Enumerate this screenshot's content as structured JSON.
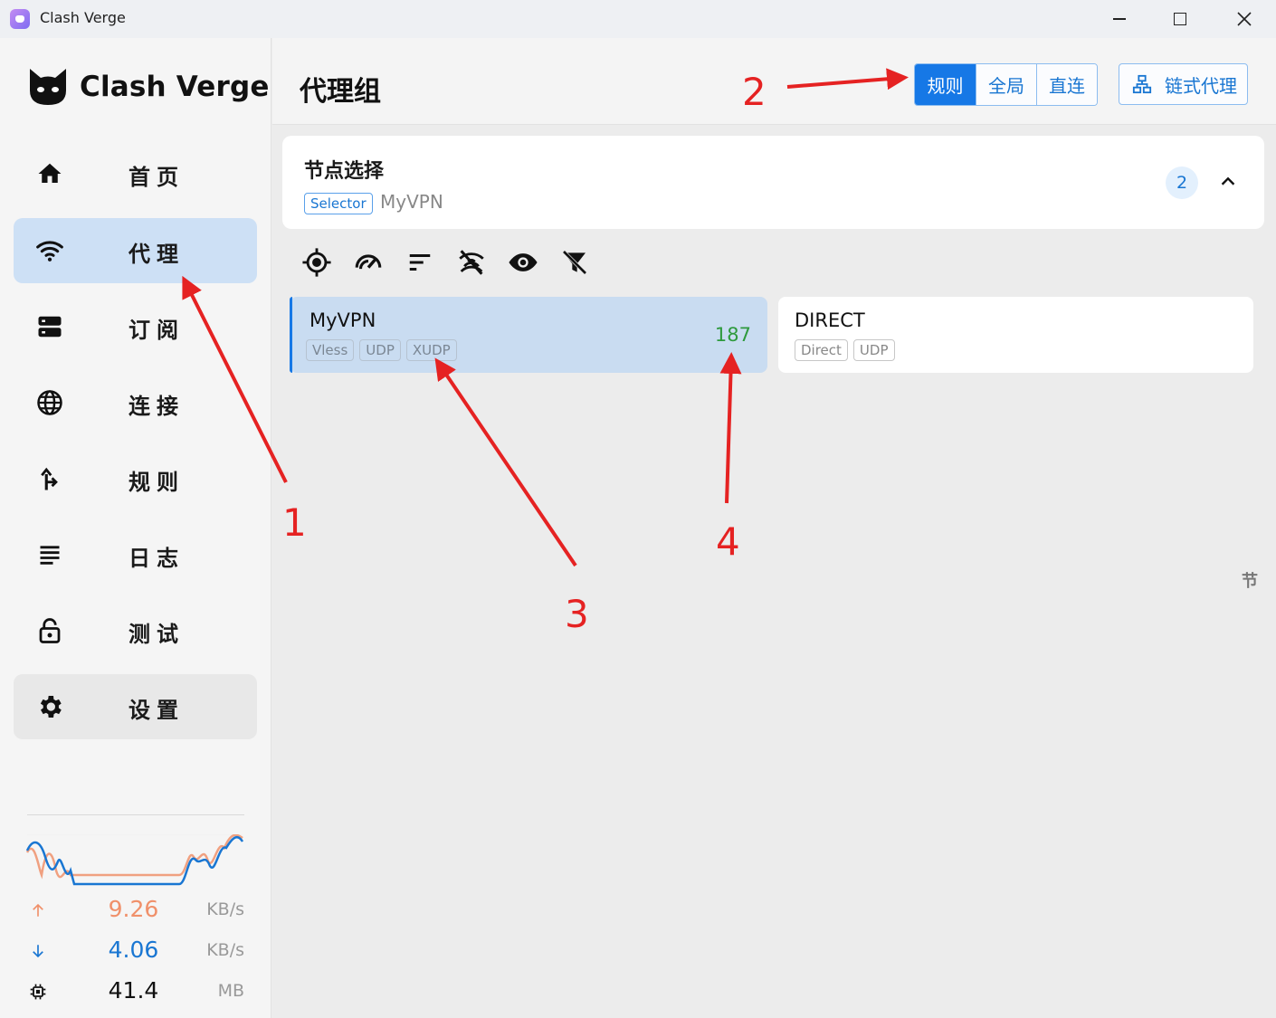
{
  "window": {
    "title": "Clash Verge"
  },
  "sidebar": {
    "logo_text": "Clash Verge",
    "items": [
      {
        "id": "home",
        "label": "首页",
        "icon": "home-icon"
      },
      {
        "id": "proxy",
        "label": "代理",
        "icon": "wifi-icon",
        "active": true
      },
      {
        "id": "subscription",
        "label": "订阅",
        "icon": "storage-icon"
      },
      {
        "id": "connections",
        "label": "连接",
        "icon": "globe-icon"
      },
      {
        "id": "rules",
        "label": "规则",
        "icon": "fork-arrow-icon"
      },
      {
        "id": "logs",
        "label": "日志",
        "icon": "lines-icon"
      },
      {
        "id": "test",
        "label": "测试",
        "icon": "unlock-icon"
      },
      {
        "id": "settings",
        "label": "设置",
        "icon": "gear-icon"
      }
    ],
    "traffic": {
      "upload": {
        "value": "9.26",
        "unit": "KB/s",
        "color": "#f0906a"
      },
      "download": {
        "value": "4.06",
        "unit": "KB/s",
        "color": "#1976d2"
      },
      "memory": {
        "value": "41.4",
        "unit": "MB"
      }
    }
  },
  "header": {
    "title": "代理组",
    "modes": [
      {
        "label": "规则",
        "active": true
      },
      {
        "label": "全局",
        "active": false
      },
      {
        "label": "直连",
        "active": false
      }
    ],
    "chain_label": "链式代理"
  },
  "group": {
    "name": "节点选择",
    "type": "Selector",
    "now": "MyVPN",
    "count": "2"
  },
  "toolbar": [
    "locate-icon",
    "speed-test-icon",
    "sort-icon",
    "hide-unavailable-icon",
    "visibility-icon",
    "filter-off-icon"
  ],
  "proxies": [
    {
      "name": "MyVPN",
      "tags": [
        "Vless",
        "UDP",
        "XUDP"
      ],
      "delay": "187",
      "selected": true
    },
    {
      "name": "DIRECT",
      "tags": [
        "Direct",
        "UDP"
      ],
      "delay": "",
      "selected": false
    }
  ],
  "side_index_letter": "节",
  "annotations": [
    "1",
    "2",
    "3",
    "4"
  ],
  "colors": {
    "accent": "#1678e6",
    "annotation": "#e52222",
    "delay_good": "#2e9a3d"
  }
}
